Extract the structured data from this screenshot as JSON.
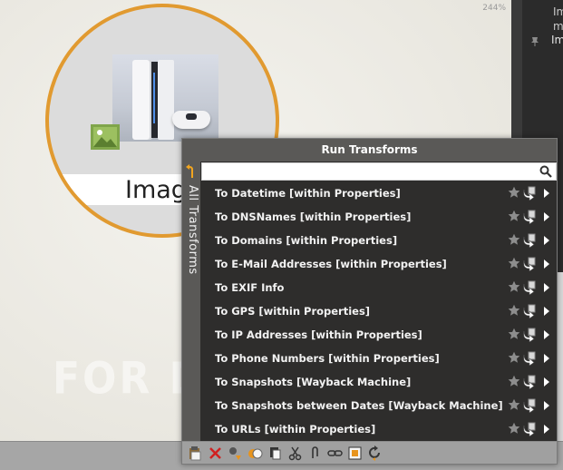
{
  "canvas": {
    "zoom_level": "244%",
    "watermark": "FOR DEM",
    "entity": {
      "label": "Imag",
      "type_icon": "image-icon",
      "thumbnail": "game-console-photo"
    }
  },
  "right_panel": {
    "line1": "Im",
    "line2": "m",
    "line3": "Im",
    "icon": "pin-icon"
  },
  "popup": {
    "title": "Run Transforms",
    "side_tab_label": "All Transforms",
    "search": {
      "value": "",
      "placeholder": ""
    },
    "transforms": [
      {
        "label": "To Datetime [within Properties]"
      },
      {
        "label": "To DNSNames [within Properties]"
      },
      {
        "label": "To Domains [within Properties]"
      },
      {
        "label": "To E-Mail Addresses [within Properties]"
      },
      {
        "label": "To EXIF Info"
      },
      {
        "label": "To GPS [within Properties]"
      },
      {
        "label": "To IP Addresses [within Properties]"
      },
      {
        "label": "To Phone Numbers [within Properties]"
      },
      {
        "label": "To Snapshots [Wayback Machine]"
      },
      {
        "label": "To Snapshots between Dates [Wayback Machine]"
      },
      {
        "label": "To URLs [within Properties]"
      }
    ],
    "toolbar": [
      "paste-icon",
      "delete-icon",
      "link-icon",
      "merge-icon",
      "copy-icon",
      "cut-icon",
      "attach-icon",
      "chain-icon",
      "select-icon",
      "refresh-icon"
    ]
  },
  "colors": {
    "accent": "#e19a30",
    "popup_bg": "#2e2d2c",
    "title_bg": "#5a5957"
  }
}
